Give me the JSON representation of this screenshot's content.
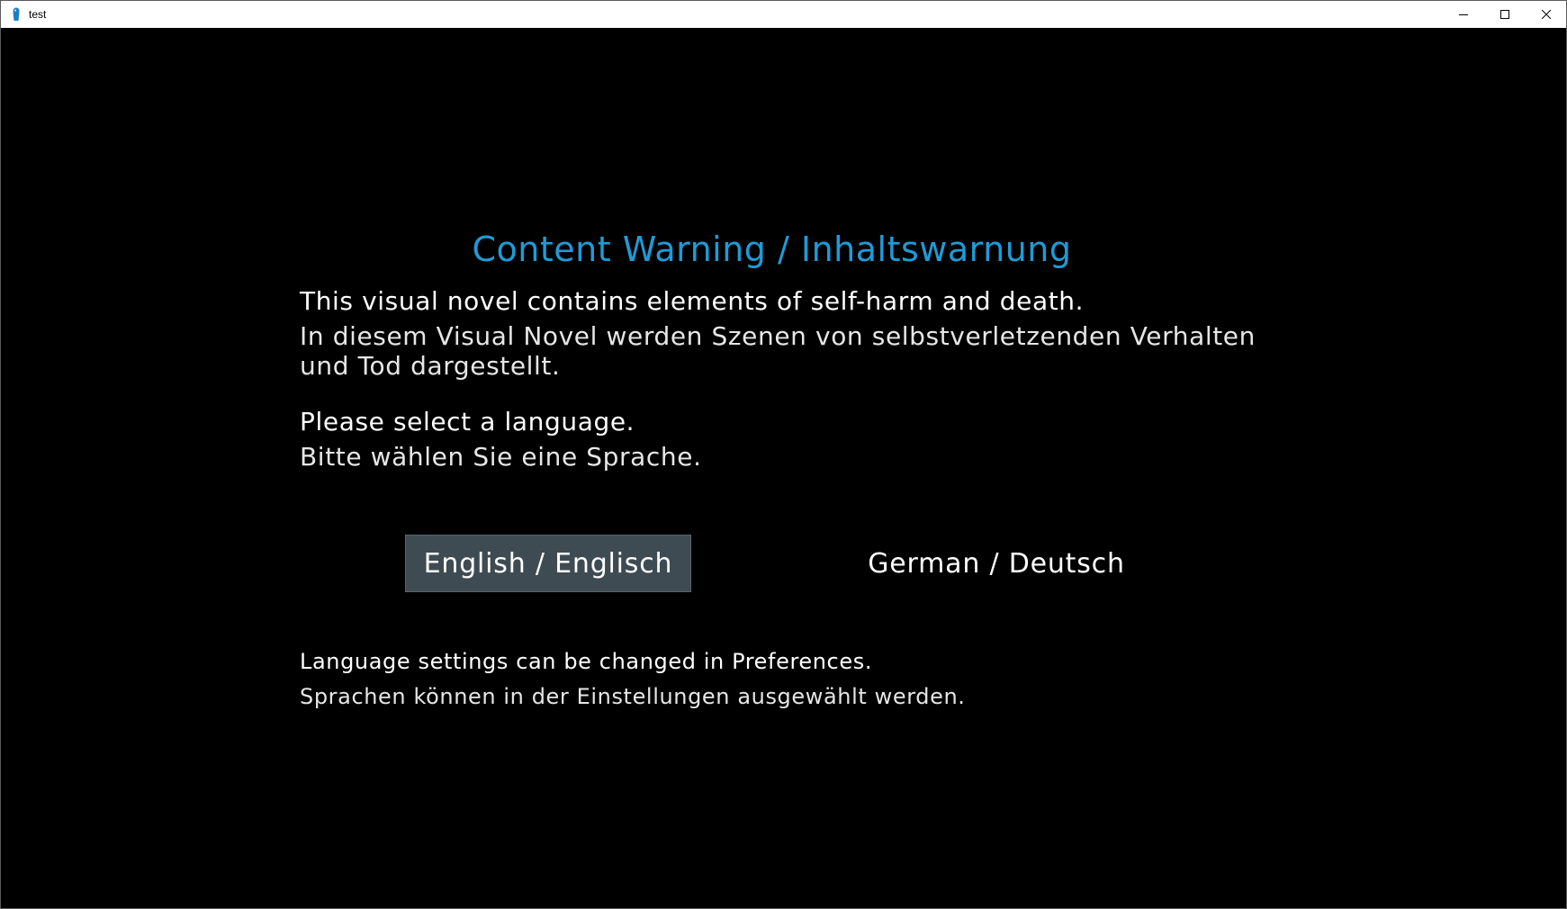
{
  "window": {
    "title": "test",
    "icon": "renpy-app-icon",
    "controls": {
      "minimize_icon": "minimize-icon",
      "maximize_icon": "maximize-icon",
      "close_icon": "close-icon"
    }
  },
  "dialog": {
    "heading": "Content Warning / Inhaltswarnung",
    "heading_color": "#1e9bd7",
    "warning_en": "This visual novel contains elements of self-harm and death.",
    "warning_de": "In diesem Visual Novel werden Szenen von selbstverletzenden Verhalten und Tod dargestellt.",
    "select_en": "Please select a language.",
    "select_de": "Bitte wählen Sie eine Sprache.",
    "buttons": [
      {
        "label": "English / Englisch",
        "selected": true
      },
      {
        "label": "German / Deutsch",
        "selected": false
      }
    ],
    "button_highlight_color": "#3f4b53",
    "footer_en": "Language settings can be changed in Preferences.",
    "footer_de": "Sprachen können in der Einstellungen ausgewählt werden."
  }
}
